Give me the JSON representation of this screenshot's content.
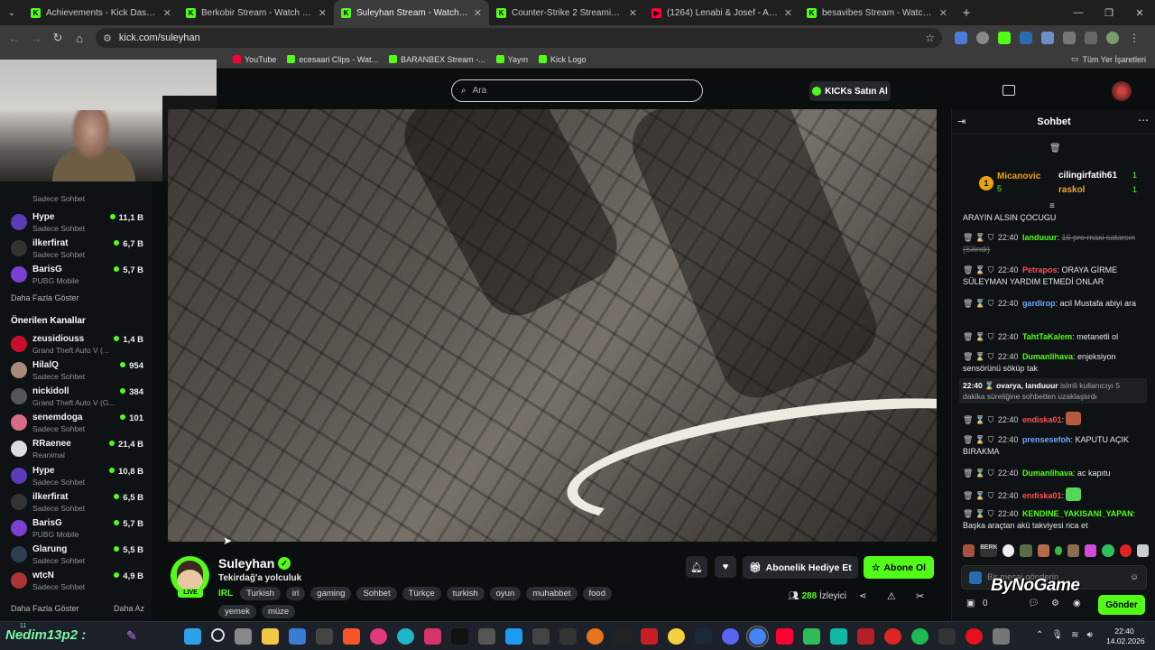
{
  "browser": {
    "tabs": [
      {
        "label": "Achievements - Kick Dashboard",
        "color": "#53fc18",
        "glyph": "K",
        "active": false
      },
      {
        "label": "Berkobir Stream - Watch Live o",
        "color": "#53fc18",
        "glyph": "K",
        "active": false
      },
      {
        "label": "Suleyhan Stream - Watch Li",
        "color": "#53fc18",
        "glyph": "K",
        "active": true
      },
      {
        "label": "Counter-Strike 2 Streaming - Li",
        "color": "#53fc18",
        "glyph": "K",
        "active": false
      },
      {
        "label": "(1264) Lenabi & Josef - Ankara",
        "color": "#ff0033",
        "glyph": "▶",
        "active": false
      },
      {
        "label": "besavibes Stream - Watch Live",
        "color": "#53fc18",
        "glyph": "K",
        "active": false
      }
    ],
    "url": "kick.com/suleyhan",
    "bookmarks": [
      {
        "label": "YouTube",
        "color": "#ff0033"
      },
      {
        "label": "ecesaari Clips - Wat...",
        "color": "#53fc18"
      },
      {
        "label": "BARANBEX Stream -...",
        "color": "#53fc18"
      },
      {
        "label": "Yayın",
        "color": "#53fc18"
      },
      {
        "label": "Kick Logo",
        "color": "#53fc18"
      }
    ],
    "bookmarks_right": "Tüm Yer İşaretleri"
  },
  "header": {
    "search_placeholder": "Ara",
    "kicks_button": "KICKs Satın Al"
  },
  "sidebar": {
    "followed_tail": [
      {
        "cat": "Sadece Sohbet"
      },
      {
        "name": "Hype",
        "cat": "Sadece Sohbet",
        "viewers": "11,1 B",
        "color": "#5b3bb8"
      },
      {
        "name": "ilkerfirat",
        "cat": "Sadece Sohbet",
        "viewers": "6,7 B",
        "color": "#333"
      },
      {
        "name": "BarisG",
        "cat": "PUBG Mobile",
        "viewers": "5,7 B",
        "color": "#7b3fd1"
      }
    ],
    "show_more": "Daha Fazla Göster",
    "recommended_heading": "Önerilen Kanallar",
    "recommended": [
      {
        "name": "zeusidiouss",
        "cat": "Grand Theft Auto V (...",
        "viewers": "1,4 B",
        "color": "#c8102e"
      },
      {
        "name": "HilalQ",
        "cat": "Sadece Sohbet",
        "viewers": "954",
        "color": "#a88a7a"
      },
      {
        "name": "nickidoll",
        "cat": "Grand Theft Auto V (G...",
        "viewers": "384",
        "color": "#555"
      },
      {
        "name": "senemdoga",
        "cat": "Sadece Sohbet",
        "viewers": "101",
        "color": "#d96b8a"
      },
      {
        "name": "RRaenee",
        "cat": "Reanimal",
        "viewers": "21,4 B",
        "color": "#ddd"
      },
      {
        "name": "Hype",
        "cat": "Sadece Sohbet",
        "viewers": "10,8 B",
        "color": "#5b3bb8"
      },
      {
        "name": "ilkerfirat",
        "cat": "Sadece Sohbet",
        "viewers": "6,5 B",
        "color": "#333"
      },
      {
        "name": "BarisG",
        "cat": "PUBG Mobile",
        "viewers": "5,7 B",
        "color": "#7b3fd1"
      },
      {
        "name": "Glarung",
        "cat": "Sadece Sohbet",
        "viewers": "5,5 B",
        "color": "#2c3e50"
      },
      {
        "name": "wtcN",
        "cat": "Sadece Sohbet",
        "viewers": "4,9 B",
        "color": "#a33"
      }
    ],
    "show_more_2": "Daha Fazla Göster",
    "show_less": "Daha Az"
  },
  "channel": {
    "name": "Suleyhan",
    "live_label": "LIVE",
    "title": "Tekirdağ'a yolculuk",
    "category": "IRL",
    "tags": [
      "Turkish",
      "irl",
      "gaming",
      "Sohbet",
      "Türkçe",
      "turkish",
      "oyun",
      "muhabbet",
      "food",
      "yemek",
      "müze"
    ],
    "gift_button": "Abonelik Hediye Et",
    "subscribe_button": "Abone Ol",
    "viewers": "288",
    "viewers_label": "İzleyici"
  },
  "chat": {
    "title": "Sohbet",
    "leaderboard": {
      "rank": "1",
      "first": {
        "name": "Micanovic",
        "count": "5"
      },
      "others": [
        {
          "name": "cilingirfatih61",
          "count": "1"
        },
        {
          "name": "raskol",
          "count": "1"
        }
      ]
    },
    "messages": [
      {
        "time": "",
        "user": "",
        "user_color": "#fff",
        "text": "ARAYIN ALSIN ÇOCUGU"
      },
      {
        "time": "22:40",
        "user": "landuuur",
        "user_color": "#53fc18",
        "text": "",
        "deleted": "16 pro maxi satarsın (Silindi)"
      },
      {
        "time": "22:40",
        "user": "Petrapos",
        "user_color": "#ff4d4d",
        "text": "ORAYA GİRME SÜLEYMAN YARDIM ETMEDİ ONLAR"
      },
      {
        "time": "22:40",
        "user": "gardirop",
        "user_color": "#6fa8ff",
        "text": "acil Mustafa abiyi ara"
      },
      {
        "time": "22:40",
        "user": "TahtTaKalem",
        "user_color": "#53fc18",
        "text": "metanetli ol"
      },
      {
        "time": "22:40",
        "user": "Dumanlihava",
        "user_color": "#53fc18",
        "text": "enjeksiyon sensörünü söküp tak"
      },
      {
        "time": "22:40",
        "user": "endiska01",
        "user_color": "#ff4d4d",
        "text": ""
      },
      {
        "time": "22:40",
        "user": "prensesefoh",
        "user_color": "#6fa8ff",
        "text": "KAPUTU AÇIK BIRAKMA"
      },
      {
        "time": "22:40",
        "user": "Dumanlihava",
        "user_color": "#53fc18",
        "text": "ac kapıtu"
      },
      {
        "time": "22:40",
        "user": "endiska01",
        "user_color": "#ff4d4d",
        "text": ""
      },
      {
        "time": "22:40",
        "user": "KENDINE_YAKISANI_YAPAN",
        "user_color": "#53fc18",
        "text": "Başka araçtan akü takviyesi rica et"
      }
    ],
    "system": {
      "time": "22:40",
      "actor": "ovarya",
      "target": "landuuur",
      "text": "isimli kullanıcıyı 5 dakika süreliğine sohbetten uzaklaştırdı"
    },
    "input_placeholder": "Bir mesaj gönderin",
    "kicks_count": "0",
    "send_button": "Gönder",
    "watermark": "ByNoGame"
  },
  "overlay": {
    "nick": "Nedim13p2 :",
    "nick_sup": "11"
  },
  "taskbar": {
    "time": "22:40",
    "date": "14.02.2026"
  },
  "colors": {
    "accent": "#53fc18",
    "bg": "#0b0e0f"
  }
}
